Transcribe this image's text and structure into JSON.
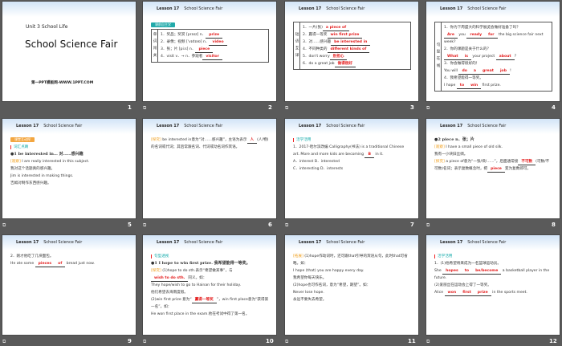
{
  "header": {
    "lesson": "Lesson 17",
    "title": "School Science Fair"
  },
  "slide1": {
    "unit": "Unit 3  School Life",
    "title": "School Science Fair",
    "footer": "第一PPT模板网-WWW.1PPT.COM"
  },
  "slides": [
    {
      "n": "2",
      "badge": "课前自主学",
      "side": "单词闯关",
      "lines": [
        [
          {
            "t": "1．奖品；奖赏 [praɪz] n．"
          },
          {
            "a": "prize"
          }
        ],
        [
          {
            "t": "2．录像；视频 ['vɪdɪəʊ] n．"
          },
          {
            "a": "video"
          }
        ],
        [
          {
            "t": "3．张；片 [piːs] n．"
          },
          {
            "a": "piece"
          }
        ],
        [
          {
            "t": "4．visit v．→ n．参观者"
          },
          {
            "a": "visitor"
          }
        ]
      ]
    },
    {
      "n": "3",
      "side": "短语互译",
      "lines": [
        [
          {
            "t": "1．一片(张)"
          },
          {
            "a": "a piece of"
          }
        ],
        [
          {
            "t": "2．赢得一等奖"
          },
          {
            "a": "win first prize"
          }
        ],
        [
          {
            "t": "3．对……感兴趣"
          },
          {
            "a": "be interested in"
          }
        ],
        [
          {
            "t": "4．不同种类的"
          },
          {
            "a": "different kinds of"
          }
        ],
        [
          {
            "t": "5．don't worry"
          },
          {
            "a": "别担心"
          }
        ],
        [
          {
            "t": "6．do a great job"
          },
          {
            "a": "做得很好"
          }
        ]
      ]
    },
    {
      "n": "4",
      "side": "句型在线",
      "lines": [
        [
          {
            "t": "1．你为下周盛大的科学展览会做好准备了吗？"
          }
        ],
        [
          {
            "a": "Are"
          },
          {
            "t": " you "
          },
          {
            "a": "ready"
          },
          {
            "a": "for"
          },
          {
            "t": " the big science fair next week?"
          }
        ],
        [
          {
            "t": "2．你的课题是关于什么的？"
          }
        ],
        [
          {
            "a": "What"
          },
          {
            "a": "is"
          },
          {
            "t": " your project "
          },
          {
            "a": "about"
          },
          {
            "t": "?"
          }
        ],
        [
          {
            "t": "3．你会做得很好的！"
          }
        ],
        [
          {
            "t": "You will "
          },
          {
            "a": "do"
          },
          {
            "a": "a"
          },
          {
            "a": "great"
          },
          {
            "a": "job"
          },
          {
            "t": "!"
          }
        ],
        [
          {
            "t": "4．我希望能得一等奖。"
          }
        ],
        [
          {
            "t": "I hope "
          },
          {
            "a": "to"
          },
          {
            "a": "win"
          },
          {
            "t": " first prize."
          }
        ]
      ]
    },
    {
      "n": "5",
      "badge": "课堂互动探",
      "section": "词汇点睛",
      "lines": [
        [
          {
            "b": "●1  be interested in… 对……感兴趣"
          }
        ],
        [
          {
            "g": "[观察]"
          },
          {
            "t": " I am really interested in this subject."
          }
        ],
        [
          {
            "t": "我对这个话题真的感兴趣。"
          }
        ],
        [
          {
            "t": "Jim is interested in making things."
          }
        ],
        [
          {
            "t": "吉姆对制作东西感兴趣。"
          }
        ]
      ]
    },
    {
      "n": "6",
      "lines": [
        [
          {
            "g": "[探究]"
          },
          {
            "t": " be interested in意为“对……感兴趣”，主语为表示"
          },
          {
            "a": "人"
          },
          {
            "t": "(人/物)的名词或代词；其后常跟名词、代词或动名词作宾语。"
          }
        ]
      ]
    },
    {
      "n": "7",
      "section": "活学活用",
      "lines": [
        [
          {
            "t": "1．2017·哈尔滨改编  Calligraphy(书法) is a traditional Chinese art. More and more kids are becoming "
          },
          {
            "a": "B"
          },
          {
            "t": " in it."
          }
        ],
        [
          {
            "t": "A．interest        B．interested"
          }
        ],
        [
          {
            "t": "C．interesting     D．interests"
          }
        ]
      ]
    },
    {
      "n": "8",
      "lines": [
        [
          {
            "b": "●2  piece  n．张；片"
          }
        ],
        [
          {
            "g": "[观察]"
          },
          {
            "t": " I have a small piece of old silk."
          }
        ],
        [
          {
            "t": "我有一小块旧丝绸。"
          }
        ],
        [
          {
            "g": "[探究]"
          },
          {
            "t": " a piece of意为“一张/块/……”，后面通常接"
          },
          {
            "a": "不可数"
          },
          {
            "t": "(可数/不可数)名词；表示复数概念时，把"
          },
          {
            "a": "piece"
          },
          {
            "t": "变为复数即可。"
          }
        ]
      ]
    },
    {
      "n": "9",
      "lines": [
        [
          {
            "t": "2．刚才他吃了几块面包。"
          }
        ],
        [
          {
            "t": "He ate some "
          },
          {
            "a": "pieces"
          },
          {
            "a": "of"
          },
          {
            "t": " bread just now."
          }
        ]
      ]
    },
    {
      "n": "10",
      "section": "句型透视",
      "lines": [
        [
          {
            "b": "●1  I hope to win first prize. 我希望能得一等奖。"
          }
        ],
        [
          {
            "g": "[探究]"
          },
          {
            "t": " (1)hope to do sth.表示“希望做某事”，与"
          },
          {
            "a": "wish to do sth."
          },
          {
            "t": "同义。如："
          }
        ],
        [
          {
            "t": "They hope/wish to go to Hainan for their holiday."
          }
        ],
        [
          {
            "t": "他们希望去海南度假。"
          }
        ],
        [
          {
            "t": "(2)win first prize 意为“"
          },
          {
            "a": "赢得一等奖"
          },
          {
            "t": "”，win first place意为“获得第一名”。如："
          }
        ],
        [
          {
            "t": "He won first place in the exam.他在考试中得了第一名。"
          }
        ]
      ]
    },
    {
      "n": "11",
      "lines": [
        [
          {
            "g": "[拓展]"
          },
          {
            "t": " (1)hope作动词时，还可跟that引导的宾语从句，此时that可省略。如："
          }
        ],
        [
          {
            "t": "I hope (that) you are happy every day."
          }
        ],
        [
          {
            "t": "我希望你每天快乐。"
          }
        ],
        [
          {
            "t": "(2)hope也可作名词，意为“希望，期望”。如："
          }
        ],
        [
          {
            "t": "Never lose hope."
          }
        ],
        [
          {
            "t": "永远不要失去希望。"
          }
        ]
      ]
    },
    {
      "n": "12",
      "section": "活学活用",
      "lines": [
        [
          {
            "t": "1．(1)他希望将来成为一名篮球运动员。"
          }
        ],
        [
          {
            "t": "She "
          },
          {
            "a": "hopes"
          },
          {
            "a": "to"
          },
          {
            "a": "be/become"
          },
          {
            "t": " a basketball player in the future."
          }
        ],
        [
          {
            "t": "(2)爱丽丝在运动会上得了一等奖。"
          }
        ],
        [
          {
            "t": "Alice "
          },
          {
            "a": "won"
          },
          {
            "a": "first"
          },
          {
            "a": "prize"
          },
          {
            "t": " in the sports meet."
          }
        ]
      ]
    }
  ],
  "slide1_number": "1",
  "transition_icon": "transition-icon"
}
